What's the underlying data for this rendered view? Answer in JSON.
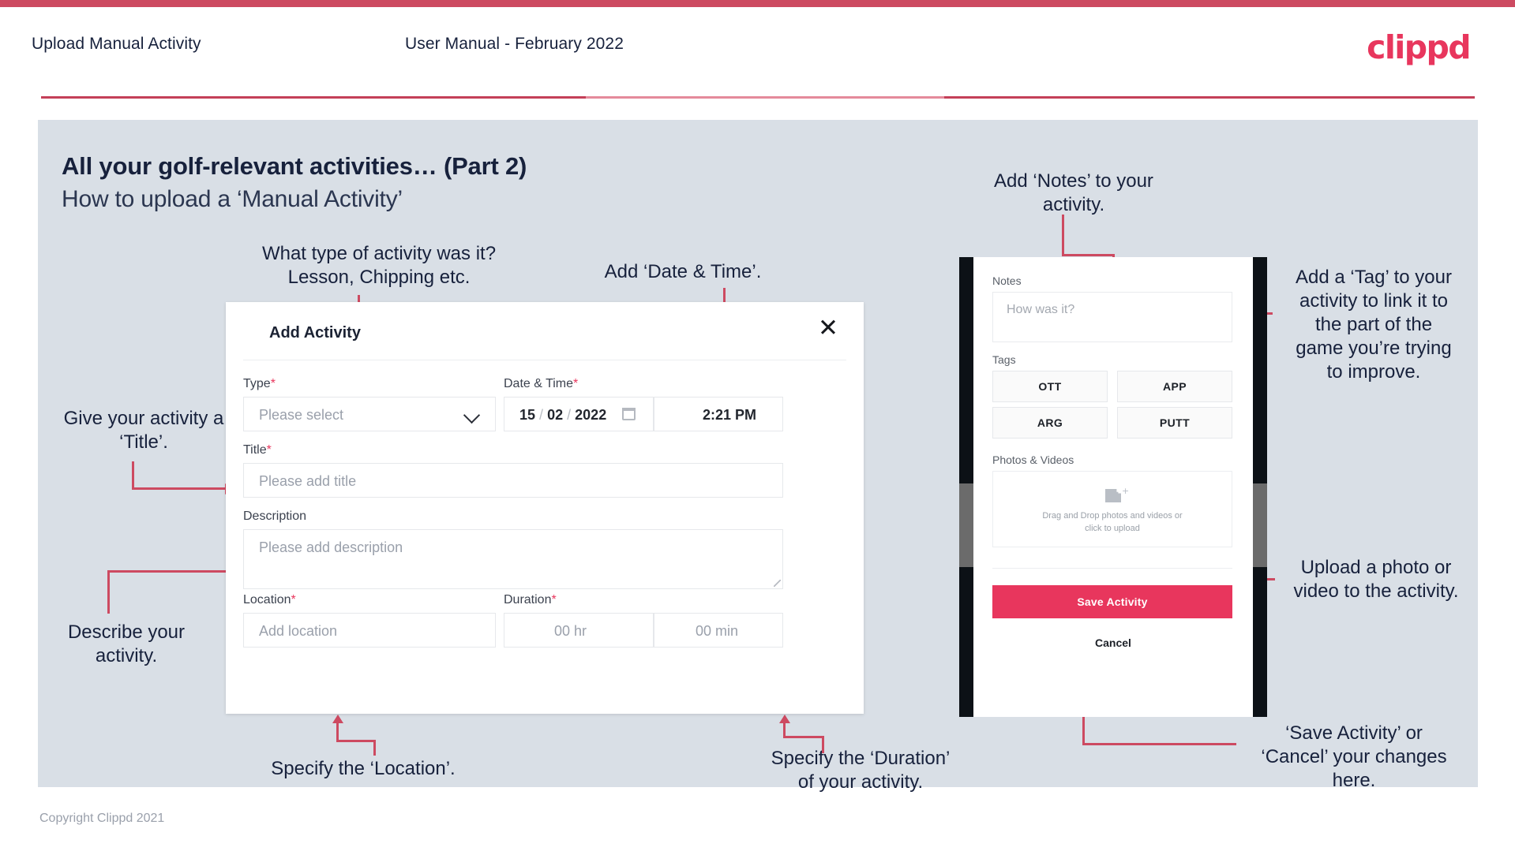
{
  "header": {
    "title": "Upload Manual Activity",
    "subtitle": "User Manual - February 2022",
    "logo": "clippd"
  },
  "slide": {
    "heading": "All your golf-relevant activities… (Part 2)",
    "subheading": "How to upload a ‘Manual Activity’"
  },
  "modal": {
    "title": "Add Activity",
    "close_icon": "close-icon",
    "fields": {
      "type": {
        "label": "Type",
        "required": "*",
        "placeholder": "Please select"
      },
      "datetime": {
        "label": "Date & Time",
        "required": "*",
        "day": "15",
        "month": "02",
        "year": "2022",
        "time": "2:21 PM",
        "sep": "/"
      },
      "title": {
        "label": "Title",
        "required": "*",
        "placeholder": "Please add title"
      },
      "description": {
        "label": "Description",
        "required": "",
        "placeholder": "Please add description"
      },
      "location": {
        "label": "Location",
        "required": "*",
        "placeholder": "Add location"
      },
      "duration": {
        "label": "Duration",
        "required": "*",
        "hours": "00 hr",
        "minutes": "00 min"
      }
    }
  },
  "phone": {
    "notes": {
      "label": "Notes",
      "placeholder": "How was it?"
    },
    "tags": {
      "label": "Tags",
      "items": [
        "OTT",
        "APP",
        "ARG",
        "PUTT"
      ]
    },
    "photos": {
      "label": "Photos & Videos",
      "drop_line1": "Drag and Drop photos and videos or",
      "drop_line2": "click to upload",
      "icon": "image-add-icon"
    },
    "save_label": "Save Activity",
    "cancel_label": "Cancel"
  },
  "annotations": {
    "type": "What type of activity was it?\nLesson, Chipping etc.",
    "datetime": "Add ‘Date & Time’.",
    "title": "Give your activity a\n‘Title’.",
    "description": "Describe your\nactivity.",
    "location": "Specify the ‘Location’.",
    "duration": "Specify the ‘Duration’\nof your activity.",
    "notes": "Add ‘Notes’ to your\nactivity.",
    "tags": "Add a ‘Tag’ to your\nactivity to link it to\nthe part of the\ngame you’re trying\nto improve.",
    "photos": "Upload a photo or\nvideo to the activity.",
    "save": "‘Save Activity’ or\n‘Cancel’ your changes\nhere."
  },
  "footer": {
    "copyright": "Copyright Clippd 2021"
  },
  "colors": {
    "accent": "#e8365d",
    "rule": "#cd4a61",
    "panel": "#d9dfe6",
    "ink": "#17213c"
  }
}
